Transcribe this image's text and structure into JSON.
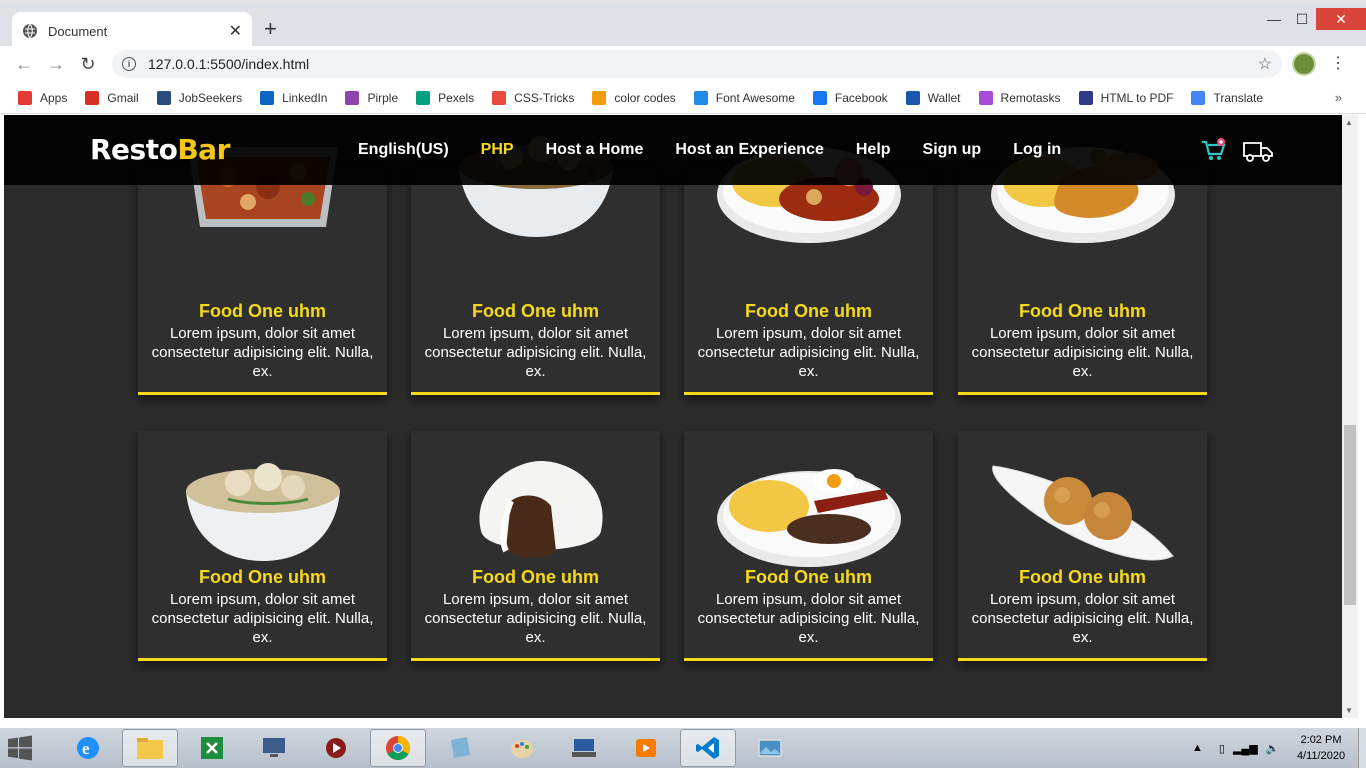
{
  "browser": {
    "tab_title": "Document",
    "url": "127.0.0.1:5500/index.html",
    "bookmarks": [
      {
        "label": "Apps",
        "color": "#e53935"
      },
      {
        "label": "Gmail",
        "color": "#d93025"
      },
      {
        "label": "JobSeekers",
        "color": "#2b4b7e"
      },
      {
        "label": "LinkedIn",
        "color": "#0a66c2"
      },
      {
        "label": "Pirple",
        "color": "#8e44ad"
      },
      {
        "label": "Pexels",
        "color": "#05a081"
      },
      {
        "label": "CSS-Tricks",
        "color": "#e94c3d"
      },
      {
        "label": "color codes",
        "color": "#f39c12"
      },
      {
        "label": "Font Awesome",
        "color": "#228ae6"
      },
      {
        "label": "Facebook",
        "color": "#1877f2"
      },
      {
        "label": "Wallet",
        "color": "#1a56b0"
      },
      {
        "label": "Remotasks",
        "color": "#a64bd6"
      },
      {
        "label": "HTML to PDF",
        "color": "#2d3a8c"
      },
      {
        "label": "Translate",
        "color": "#4285f4"
      }
    ],
    "bookmarks_more": "»"
  },
  "site": {
    "logo_part1": "Resto",
    "logo_part2": "Bar",
    "nav": [
      {
        "label": "English(US)",
        "active": false
      },
      {
        "label": "PHP",
        "active": true
      },
      {
        "label": "Host a Home",
        "active": false
      },
      {
        "label": "Host an Experience",
        "active": false
      },
      {
        "label": "Help",
        "active": false
      },
      {
        "label": "Sign up",
        "active": false
      },
      {
        "label": "Log in",
        "active": false
      }
    ],
    "accent_color": "#f5d91a",
    "cards": [
      {
        "name": "Food One uhm",
        "desc": "Lorem ipsum, dolor sit amet consectetur adipisicing elit. Nulla, ex.",
        "image": "container-food"
      },
      {
        "name": "Food One uhm",
        "desc": "Lorem ipsum, dolor sit amet consectetur adipisicing elit. Nulla, ex.",
        "image": "rice-bowl"
      },
      {
        "name": "Food One uhm",
        "desc": "Lorem ipsum, dolor sit amet consectetur adipisicing elit. Nulla, ex.",
        "image": "rice-plate"
      },
      {
        "name": "Food One uhm",
        "desc": "Lorem ipsum, dolor sit amet consectetur adipisicing elit. Nulla, ex.",
        "image": "chicken-plate"
      },
      {
        "name": "Food One uhm",
        "desc": "Lorem ipsum, dolor sit amet consectetur adipisicing elit. Nulla, ex.",
        "image": "noodle-bowl"
      },
      {
        "name": "Food One uhm",
        "desc": "Lorem ipsum, dolor sit amet consectetur adipisicing elit. Nulla, ex.",
        "image": "siopao"
      },
      {
        "name": "Food One uhm",
        "desc": "Lorem ipsum, dolor sit amet consectetur adipisicing elit. Nulla, ex.",
        "image": "breakfast-plate"
      },
      {
        "name": "Food One uhm",
        "desc": "Lorem ipsum, dolor sit amet consectetur adipisicing elit. Nulla, ex.",
        "image": "sesame-balls"
      }
    ]
  },
  "taskbar": {
    "time": "2:02 PM",
    "date": "4/11/2020"
  }
}
